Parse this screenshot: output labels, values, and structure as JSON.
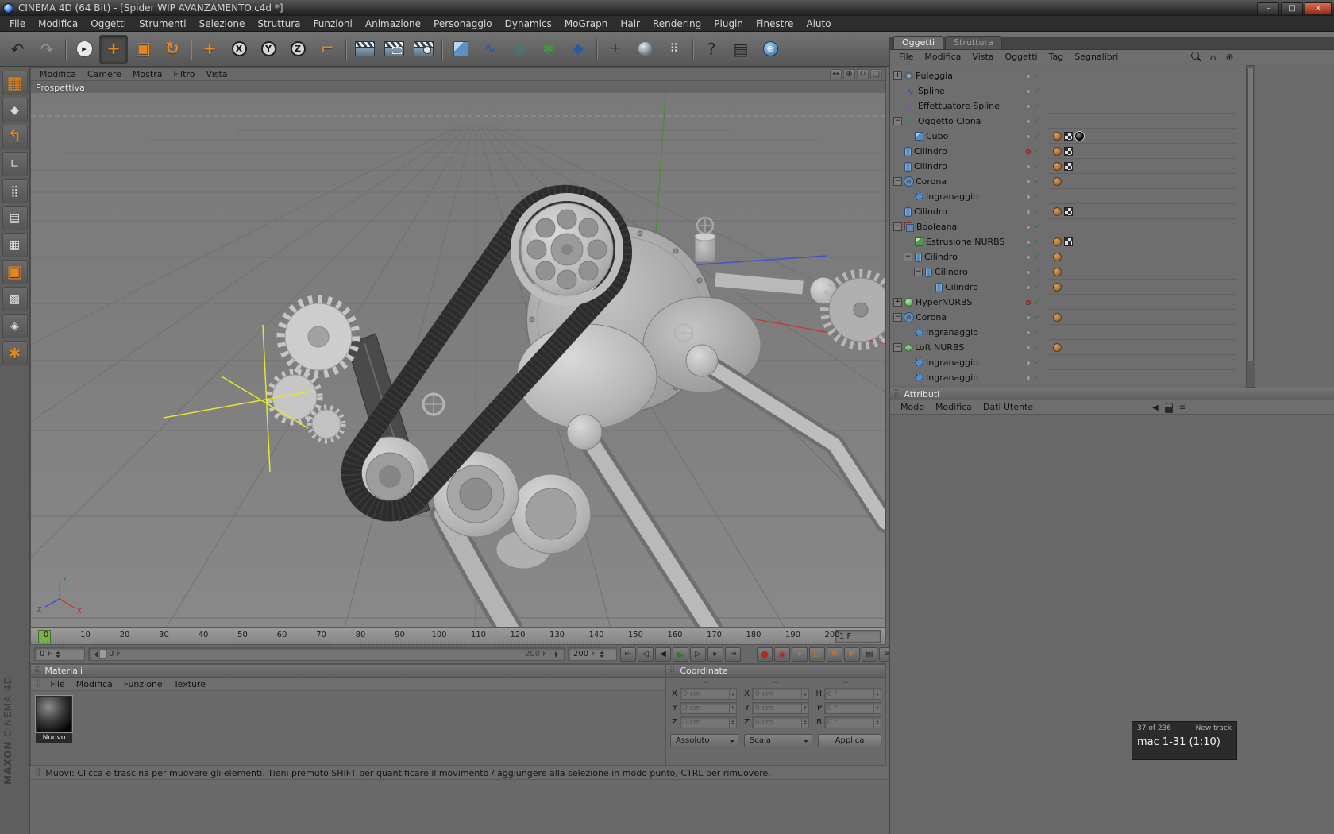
{
  "window": {
    "title": "CINEMA 4D (64 Bit) - [Spider WIP AVANZAMENTO.c4d *]",
    "buttons": [
      {
        "name": "minimize",
        "glyph": "–"
      },
      {
        "name": "maximize",
        "glyph": "□"
      },
      {
        "name": "close",
        "glyph": "×"
      }
    ]
  },
  "menubar": {
    "items": [
      "File",
      "Modifica",
      "Oggetti",
      "Strumenti",
      "Selezione",
      "Struttura",
      "Funzioni",
      "Animazione",
      "Personaggio",
      "Dynamics",
      "MoGraph",
      "Hair",
      "Rendering",
      "Plugin",
      "Finestre",
      "Aiuto"
    ]
  },
  "toolbar": {
    "buttons": [
      {
        "name": "undo",
        "glyph": "↶",
        "style": "dark"
      },
      {
        "name": "redo",
        "glyph": "↷",
        "style": "disabled"
      },
      {
        "sep": true
      },
      {
        "name": "live-selection",
        "glyph": "▸",
        "style": "selection"
      },
      {
        "name": "move-tool",
        "glyph": "+",
        "style": "orange",
        "pressed": true
      },
      {
        "name": "scale-tool",
        "glyph": "▣",
        "style": "orange"
      },
      {
        "name": "rotate-tool",
        "glyph": "↻",
        "style": "orange"
      },
      {
        "sep": true
      },
      {
        "name": "last-tool",
        "glyph": "+",
        "style": "orange"
      },
      {
        "name": "lock-x-axis",
        "glyph": "X",
        "style": "axis"
      },
      {
        "name": "lock-y-axis",
        "glyph": "Y",
        "style": "axis"
      },
      {
        "name": "lock-z-axis",
        "glyph": "Z",
        "style": "axis"
      },
      {
        "name": "coordinate-system",
        "glyph": "⌐",
        "style": "orange"
      },
      {
        "sep": true
      },
      {
        "name": "render-view",
        "glyph": "",
        "style": "clap"
      },
      {
        "name": "render-region",
        "glyph": "",
        "style": "clap clap2"
      },
      {
        "name": "render-settings",
        "glyph": "",
        "style": "clap clap3"
      },
      {
        "sep": true
      },
      {
        "name": "add-primitive",
        "glyph": "",
        "style": "cube"
      },
      {
        "name": "add-spline",
        "glyph": "∿",
        "style": "blue"
      },
      {
        "name": "add-nurbs",
        "glyph": "◎",
        "style": "teal"
      },
      {
        "name": "add-mograph",
        "glyph": "∗",
        "style": "green"
      },
      {
        "name": "add-deformer",
        "glyph": "◆",
        "style": "blue"
      },
      {
        "sep": true
      },
      {
        "name": "axis-modifier",
        "glyph": "+",
        "style": "gray"
      },
      {
        "name": "display-filter",
        "glyph": "",
        "style": "glass"
      },
      {
        "name": "snap-settings",
        "glyph": "⠿",
        "style": "dots"
      },
      {
        "sep": true
      },
      {
        "name": "help",
        "glyph": "?",
        "style": "dark"
      },
      {
        "name": "content-browser",
        "glyph": "▤",
        "style": "dark"
      },
      {
        "name": "online-updater",
        "glyph": "⊕",
        "style": "globe"
      }
    ]
  },
  "sidebar": {
    "buttons": [
      {
        "name": "make-editable",
        "glyph": "▦",
        "style": "orange"
      },
      {
        "name": "model-mode",
        "glyph": "◆",
        "style": "silver"
      },
      {
        "name": "texture-mode",
        "glyph": "↰",
        "style": "orange"
      },
      {
        "name": "workplane-mode",
        "glyph": "∟",
        "style": "light"
      },
      {
        "name": "points-mode",
        "glyph": "⣿",
        "style": "light"
      },
      {
        "name": "edges-mode",
        "glyph": "▤",
        "style": "light"
      },
      {
        "name": "polygons-mode",
        "glyph": "▦",
        "style": "light"
      },
      {
        "name": "object-axis-mode",
        "glyph": "▣",
        "style": "orange"
      },
      {
        "name": "texture-axis-mode",
        "glyph": "▩",
        "style": "light"
      },
      {
        "name": "snap-mode",
        "glyph": "◈",
        "style": "light"
      },
      {
        "name": "viewport-solo",
        "glyph": "∗",
        "style": "orange"
      }
    ]
  },
  "viewport": {
    "menu": [
      "Modifica",
      "Camere",
      "Mostra",
      "Filtro",
      "Vista"
    ],
    "label": "Prospettiva",
    "view_icons": [
      {
        "name": "pan-view",
        "glyph": "↔"
      },
      {
        "name": "zoom-view",
        "glyph": "⊕"
      },
      {
        "name": "rotate-view",
        "glyph": "↻"
      },
      {
        "name": "toggle-view",
        "glyph": "□"
      }
    ]
  },
  "object_manager": {
    "tabs": [
      {
        "label": "Oggetti",
        "active": true
      },
      {
        "label": "Struttura",
        "active": false
      }
    ],
    "menu": [
      "File",
      "Modifica",
      "Vista",
      "Oggetti",
      "Tag",
      "Segnalibri"
    ],
    "icons": [
      {
        "name": "search",
        "glyph": ""
      },
      {
        "name": "home",
        "glyph": "⌂"
      },
      {
        "name": "target",
        "glyph": "⊕"
      }
    ],
    "check_glyph": "✓",
    "tree": [
      {
        "label": "Puleggia",
        "depth": 0,
        "expand": "+",
        "icon": "pulley",
        "tags": []
      },
      {
        "label": "Spline",
        "depth": 0,
        "expand": "",
        "icon": "spline",
        "tags": []
      },
      {
        "label": "Effettuatore Spline",
        "depth": 0,
        "expand": "",
        "icon": "spline-effector",
        "tags": []
      },
      {
        "label": "Oggetto Clona",
        "depth": 0,
        "expand": "−",
        "icon": "cloner",
        "tags": []
      },
      {
        "label": "Cubo",
        "depth": 1,
        "expand": "",
        "icon": "cube",
        "tags": [
          "material-brown",
          "texture-checker",
          "material-sphere"
        ]
      },
      {
        "label": "Cilindro",
        "depth": 0,
        "expand": "",
        "icon": "cylinder",
        "vis": "red",
        "tags": [
          "material-brown",
          "texture-checker"
        ]
      },
      {
        "label": "Cilindro",
        "depth": 0,
        "expand": "",
        "icon": "cylinder",
        "tags": [
          "material-brown",
          "texture-checker"
        ]
      },
      {
        "label": "Corona",
        "depth": 0,
        "expand": "−",
        "icon": "ring",
        "tags": [
          "material-brown"
        ]
      },
      {
        "label": "Ingranaggio",
        "depth": 1,
        "expand": "",
        "icon": "gear",
        "tags": []
      },
      {
        "label": "Cilindro",
        "depth": 0,
        "expand": "",
        "icon": "cylinder",
        "tags": [
          "material-brown",
          "texture-checker"
        ]
      },
      {
        "label": "Booleana",
        "depth": 0,
        "expand": "−",
        "icon": "boolean",
        "tags": []
      },
      {
        "label": "Estrusione NURBS",
        "depth": 1,
        "expand": "",
        "icon": "extrude-nurbs",
        "tags": [
          "material-brown",
          "texture-checker"
        ]
      },
      {
        "label": "Cilindro",
        "depth": 1,
        "expand": "−",
        "icon": "cylinder",
        "tags": [
          "material-brown"
        ]
      },
      {
        "label": "Cilindro",
        "depth": 2,
        "expand": "−",
        "icon": "cylinder",
        "tags": [
          "material-brown"
        ]
      },
      {
        "label": "Cilindro",
        "depth": 3,
        "expand": "",
        "icon": "cylinder",
        "tags": [
          "material-brown"
        ]
      },
      {
        "label": "HyperNURBS",
        "depth": 0,
        "expand": "+",
        "icon": "hypernurbs",
        "vis": "red",
        "tags": []
      },
      {
        "label": "Corona",
        "depth": 0,
        "expand": "−",
        "icon": "ring",
        "tags": [
          "material-brown"
        ]
      },
      {
        "label": "Ingranaggio",
        "depth": 1,
        "expand": "",
        "icon": "gear",
        "tags": []
      },
      {
        "label": "Loft NURBS",
        "depth": 0,
        "expand": "−",
        "icon": "loft-nurbs",
        "tags": [
          "material-brown"
        ]
      },
      {
        "label": "Ingranaggio",
        "depth": 1,
        "expand": "",
        "icon": "gear",
        "tags": []
      },
      {
        "label": "Ingranaggio",
        "depth": 1,
        "expand": "",
        "icon": "gear",
        "tags": []
      }
    ]
  },
  "attributes": {
    "title": "Attributi",
    "menu": [
      "Modo",
      "Modifica",
      "Dati Utente"
    ],
    "icons": [
      {
        "name": "history-back",
        "glyph": "◀"
      },
      {
        "name": "lock",
        "glyph": ""
      },
      {
        "name": "panel-menu",
        "glyph": "≡"
      }
    ]
  },
  "timeline": {
    "ticks": [
      "0",
      "10",
      "20",
      "30",
      "40",
      "50",
      "60",
      "70",
      "80",
      "90",
      "100",
      "110",
      "120",
      "130",
      "140",
      "150",
      "160",
      "170",
      "180",
      "190",
      "200"
    ],
    "frame_box": "1 F"
  },
  "transport": {
    "current_frame": "0 F",
    "slider_start_label": "0 F",
    "slider_end_label": "200 F",
    "end_frame": "200 F",
    "buttons": [
      {
        "name": "goto-start",
        "glyph": "⇤"
      },
      {
        "name": "previous-key",
        "glyph": "◁"
      },
      {
        "name": "previous-frame",
        "glyph": "◀"
      },
      {
        "name": "play",
        "glyph": "▶",
        "variant": "play"
      },
      {
        "name": "next-frame",
        "glyph": "▷"
      },
      {
        "name": "next-key",
        "glyph": "▸"
      },
      {
        "name": "goto-end",
        "glyph": "⇥"
      }
    ],
    "record_buttons": [
      {
        "name": "record-keyframe",
        "glyph": "●",
        "variant": "red"
      },
      {
        "name": "autokeying",
        "glyph": "◉",
        "variant": "red"
      },
      {
        "name": "record-position",
        "glyph": "+",
        "variant": "orange"
      },
      {
        "name": "record-scale",
        "glyph": "□",
        "variant": "orange"
      },
      {
        "name": "record-rotation",
        "glyph": "↻",
        "variant": "orange"
      },
      {
        "name": "record-parameter",
        "glyph": "P",
        "variant": "orange"
      },
      {
        "name": "record-pla",
        "glyph": "▤",
        "variant": "grayv"
      },
      {
        "name": "playback-options",
        "glyph": "≡",
        "variant": "grayv"
      },
      {
        "name": "loop-playback",
        "glyph": "↺",
        "variant": "grayv"
      }
    ]
  },
  "materials": {
    "title": "Materiali",
    "menu": [
      "File",
      "Modifica",
      "Funzione",
      "Texture"
    ],
    "items": [
      {
        "name": "Nuovo"
      }
    ]
  },
  "coordinates": {
    "title": "Coordinate",
    "column_headers": [
      "--",
      "--",
      "--"
    ],
    "position": {
      "labels": [
        "X",
        "Y",
        "Z"
      ],
      "values": [
        "0 cm",
        "0 cm",
        "0 cm"
      ]
    },
    "scale": {
      "labels": [
        "X",
        "Y",
        "Z"
      ],
      "values": [
        "0 cm",
        "0 cm",
        "0 cm"
      ]
    },
    "rotation": {
      "labels": [
        "H",
        "P",
        "B"
      ],
      "values": [
        "0 °",
        "0 °",
        "0 °"
      ]
    },
    "mode_dropdown": "Assoluto",
    "scale_dropdown": "Scala",
    "apply_button": "Applica"
  },
  "statusbar": {
    "text": "Muovi: Clicca e trascina per muovere gli elementi. Tieni premuto SHIFT per quantificare il movimento / aggiungere alla selezione in modo punto, CTRL per rimuovere."
  },
  "popup": {
    "count": "37 of 236",
    "action": "New track",
    "label": "mac 1-31 (1:10)"
  },
  "brand": {
    "line1": "MAXON",
    "line2": "CINEMA 4D"
  }
}
